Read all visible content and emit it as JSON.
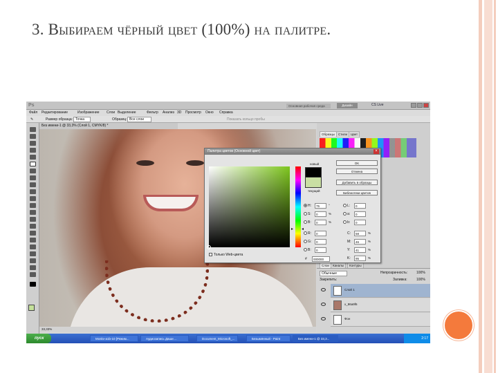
{
  "slide": {
    "title": "3. Выбираем чёрный цвет (100%) на палитре."
  },
  "app": {
    "logo": "Ps",
    "workspace_label": "Основная рабочая среда",
    "design_button": "Дизайн",
    "cs_live": "CS Live",
    "menu": [
      "Файл",
      "Редактирование",
      "Изображение",
      "Слои",
      "Выделение",
      "Фильтр",
      "Анализ",
      "3D",
      "Просмотр",
      "Окно",
      "Справка"
    ],
    "options": {
      "brush_size_label": "Размер образца:",
      "brush_size_value": "Точка",
      "sample_label": "Образец:",
      "sample_value": "Все слои",
      "extra": "Показать кольцо пробы"
    },
    "doc_tab": "Без имени-1 @ 33,3% (Слой 1, CMYK/8) *",
    "status_zoom": "33,33%"
  },
  "panels": {
    "tabs_top": [
      "Образцы",
      "Стили",
      "Цвет"
    ],
    "tabs_layers": [
      "Слои",
      "Каналы",
      "Контуры"
    ],
    "blend_mode": "Обычные",
    "opacity_label": "Непрозрачность:",
    "opacity_value": "100%",
    "lock_label": "Закрепить:",
    "fill_label": "Заливка:",
    "fill_value": "100%",
    "layers": [
      {
        "name": "Слой 1",
        "selected": true
      },
      {
        "name": "x_86a9f6",
        "selected": false
      },
      {
        "name": "Фон",
        "selected": false
      }
    ]
  },
  "dialog": {
    "title": "Палитра цветов (Основной цвет)",
    "close": "×",
    "label_new": "новый",
    "label_current": "текущий",
    "buttons": {
      "ok": "OK",
      "cancel": "Отмена",
      "add_swatch": "Добавить в образцы",
      "color_library": "Библиотеки цветов"
    },
    "web_only": "Только Web-цвета",
    "fields": {
      "H": {
        "label": "H:",
        "value": "75",
        "unit": "°"
      },
      "S": {
        "label": "S:",
        "value": "0",
        "unit": "%"
      },
      "Bv": {
        "label": "B:",
        "value": "0",
        "unit": "%"
      },
      "R": {
        "label": "R:",
        "value": "0"
      },
      "G": {
        "label": "G:",
        "value": "0"
      },
      "Bc": {
        "label": "B:",
        "value": "0"
      },
      "hex_label": "#",
      "hex": "000000",
      "L": {
        "label": "L:",
        "value": "0"
      },
      "a": {
        "label": "a:",
        "value": "0"
      },
      "b": {
        "label": "b:",
        "value": "0"
      },
      "C": {
        "label": "C:",
        "value": "58",
        "unit": "%"
      },
      "M": {
        "label": "M:",
        "value": "46",
        "unit": "%"
      },
      "Y": {
        "label": "Y:",
        "value": "41",
        "unit": "%"
      },
      "K": {
        "label": "K:",
        "value": "95",
        "unit": "%"
      }
    },
    "colors": {
      "new": "#000000",
      "current": "#c9dfa3",
      "field_hue": "#7ec61e"
    }
  },
  "taskbar": {
    "start": "пуск",
    "tasks": [
      "Moskv-a1b-10 [Режим...",
      "Аудиозапись Даши ...",
      "Document_Microsoft_...",
      "Безымянный - Paint",
      "Без имени-1 @ 33,3..."
    ],
    "clock": "2:17"
  }
}
